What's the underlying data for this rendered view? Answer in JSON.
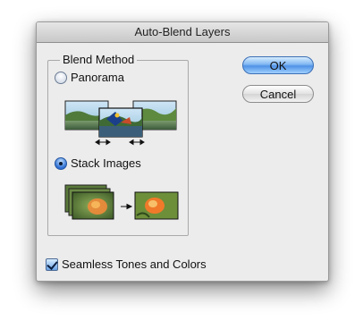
{
  "dialog": {
    "title": "Auto-Blend Layers",
    "ok_label": "OK",
    "cancel_label": "Cancel"
  },
  "blend_method": {
    "legend": "Blend Method",
    "options": [
      {
        "label": "Panorama",
        "selected": false
      },
      {
        "label": "Stack Images",
        "selected": true
      }
    ]
  },
  "seamless": {
    "label": "Seamless Tones and Colors",
    "checked": true
  },
  "icons": {
    "panorama_preview": "panorama-thumbnails-icon",
    "stack_preview": "stacked-flower-thumbnails-icon",
    "arrow": "right-arrow-icon",
    "double_arrow": "double-headed-arrow-icon"
  },
  "colors": {
    "accent": "#4f92e6",
    "dialog_bg": "#ececec"
  }
}
